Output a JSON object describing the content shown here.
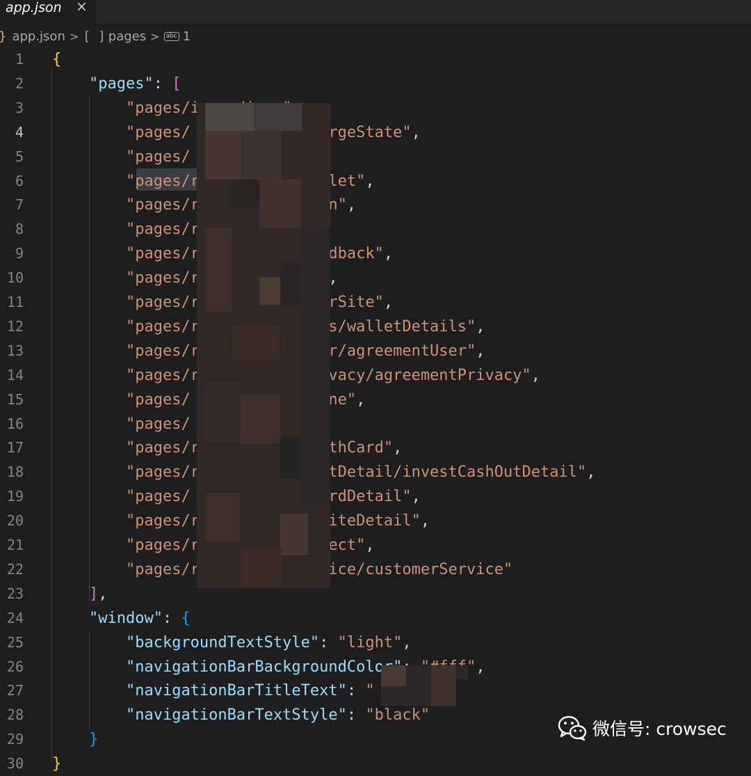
{
  "tab": {
    "title": "app.json",
    "close_icon": "×"
  },
  "breadcrumb": {
    "brace": "}",
    "file": "app.json",
    "array_icon": "[ ]",
    "array": "pages",
    "string_icon": "abc",
    "item": "1"
  },
  "active_line": 4,
  "lines": [
    {
      "n": "1",
      "t": [
        [
          "b1",
          "{"
        ]
      ]
    },
    {
      "n": "2",
      "t": [
        [
          "p",
          "    "
        ],
        [
          "k",
          "\"pages\""
        ],
        [
          "p",
          ": "
        ],
        [
          "b2",
          "["
        ]
      ]
    },
    {
      "n": "3",
      "t": [
        [
          "p",
          "        "
        ],
        [
          "s",
          "\"pages/i    /i   \""
        ],
        [
          "p",
          ","
        ]
      ]
    },
    {
      "n": "4",
      "t": [
        [
          "p",
          "        "
        ],
        [
          "s",
          "\"pages/           /chargeState\""
        ],
        [
          "p",
          ","
        ]
      ]
    },
    {
      "n": "5",
      "t": [
        [
          "p",
          "        "
        ],
        [
          "s",
          "\"pages/          \""
        ],
        [
          "p",
          ","
        ]
      ]
    },
    {
      "n": "6",
      "t": [
        [
          "p",
          "        "
        ],
        [
          "s",
          "\"pages/r          /wallet\""
        ],
        [
          "p",
          ","
        ]
      ]
    },
    {
      "n": "7",
      "t": [
        [
          "p",
          "        "
        ],
        [
          "s",
          "\"pages/r           upon\""
        ],
        [
          "p",
          ","
        ]
      ]
    },
    {
      "n": "8",
      "t": [
        [
          "p",
          "        "
        ],
        [
          "s",
          "\"pages/r"
        ]
      ]
    },
    {
      "n": "9",
      "t": [
        [
          "p",
          "        "
        ],
        [
          "s",
          "\"pages/r           feedback\""
        ],
        [
          "p",
          ","
        ]
      ]
    },
    {
      "n": "10",
      "t": [
        [
          "p",
          "        "
        ],
        [
          "s",
          "\"pages/r           ut\""
        ],
        [
          "p",
          ","
        ]
      ]
    },
    {
      "n": "11",
      "t": [
        [
          "p",
          "        "
        ],
        [
          "s",
          "\"pages/r           nearSite\""
        ],
        [
          "p",
          ","
        ]
      ]
    },
    {
      "n": "12",
      "t": [
        [
          "p",
          "        "
        ],
        [
          "s",
          "\"pages/r           ails/walletDetails\""
        ],
        [
          "p",
          ","
        ]
      ]
    },
    {
      "n": "13",
      "t": [
        [
          "p",
          "        "
        ],
        [
          "s",
          "\"pages/r           User/agreementUser\""
        ],
        [
          "p",
          ","
        ]
      ]
    },
    {
      "n": "14",
      "t": [
        [
          "p",
          "        "
        ],
        [
          "s",
          "\"pages/r           Privacy/agreementPrivacy\""
        ],
        [
          "p",
          ","
        ]
      ]
    },
    {
      "n": "15",
      "t": [
        [
          "p",
          "        "
        ],
        [
          "s",
          "\"pages/            Phone\""
        ],
        [
          "p",
          ","
        ]
      ]
    },
    {
      "n": "16",
      "t": [
        [
          "p",
          "        "
        ],
        [
          "s",
          "\"pages/"
        ]
      ]
    },
    {
      "n": "17",
      "t": [
        [
          "p",
          "        "
        ],
        [
          "s",
          "\"pages/r          /monthCard\""
        ],
        [
          "p",
          ","
        ]
      ]
    },
    {
      "n": "18",
      "t": [
        [
          "p",
          "        "
        ],
        [
          "s",
          "\"pages/r           hOutDetail/investCashOutDetail\""
        ],
        [
          "p",
          ","
        ]
      ]
    },
    {
      "n": "19",
      "t": [
        [
          "p",
          "        "
        ],
        [
          "s",
          "\"pages/            ecordDetail\""
        ],
        [
          "p",
          ","
        ]
      ]
    },
    {
      "n": "20",
      "t": [
        [
          "p",
          "        "
        ],
        [
          "s",
          "\"pages/r           l/siteDetail\""
        ],
        [
          "p",
          ","
        ]
      ]
    },
    {
      "n": "21",
      "t": [
        [
          "p",
          "        "
        ],
        [
          "s",
          "\"pages/r           ollect\""
        ],
        [
          "p",
          ","
        ]
      ]
    },
    {
      "n": "22",
      "t": [
        [
          "p",
          "        "
        ],
        [
          "s",
          "\"pages/r           ervice/customerService\""
        ]
      ]
    },
    {
      "n": "23",
      "t": [
        [
          "p",
          "    "
        ],
        [
          "b2",
          "]"
        ],
        [
          "p",
          ","
        ]
      ]
    },
    {
      "n": "24",
      "t": [
        [
          "p",
          "    "
        ],
        [
          "k",
          "\"window\""
        ],
        [
          "p",
          ": "
        ],
        [
          "b3",
          "{"
        ]
      ]
    },
    {
      "n": "25",
      "t": [
        [
          "p",
          "        "
        ],
        [
          "k",
          "\"backgroundTextStyle\""
        ],
        [
          "p",
          ": "
        ],
        [
          "s",
          "\"light\""
        ],
        [
          "p",
          ","
        ]
      ]
    },
    {
      "n": "26",
      "t": [
        [
          "p",
          "        "
        ],
        [
          "k",
          "\"navigationBarBackgroundColor\""
        ],
        [
          "p",
          ": "
        ],
        [
          "s",
          "\"#fff\""
        ],
        [
          "p",
          ","
        ]
      ]
    },
    {
      "n": "27",
      "t": [
        [
          "p",
          "        "
        ],
        [
          "k",
          "\"navigationBarTitleText\""
        ],
        [
          "p",
          ": "
        ],
        [
          "s",
          "\"    "
        ]
      ]
    },
    {
      "n": "28",
      "t": [
        [
          "p",
          "        "
        ],
        [
          "k",
          "\"navigationBarTextStyle\""
        ],
        [
          "p",
          ": "
        ],
        [
          "s",
          "\"black\""
        ]
      ]
    },
    {
      "n": "29",
      "t": [
        [
          "p",
          "    "
        ],
        [
          "b3",
          "}"
        ]
      ]
    },
    {
      "n": "30",
      "t": [
        [
          "b1",
          "}"
        ]
      ]
    }
  ],
  "watermark": {
    "icon": "wechat-icon",
    "text": "微信号: crowsec"
  }
}
